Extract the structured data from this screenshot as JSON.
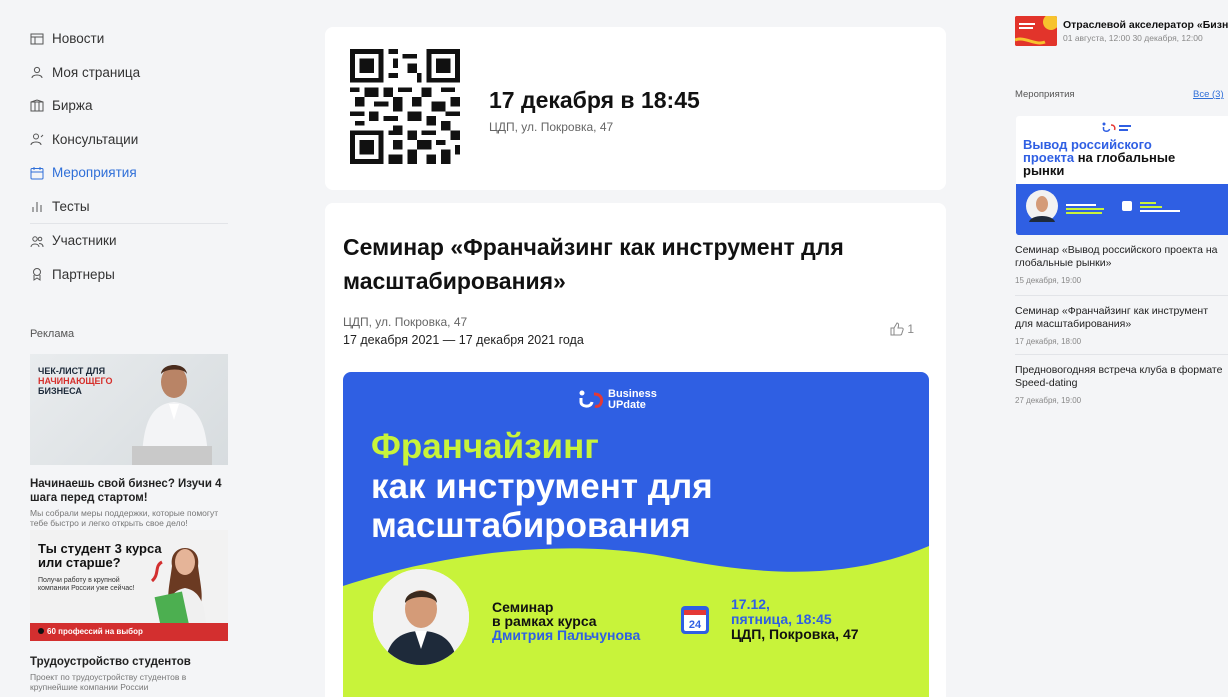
{
  "sidebar": {
    "items": [
      {
        "label": "Новости",
        "icon": "newspaper-icon",
        "active": false
      },
      {
        "label": "Моя страница",
        "icon": "user-icon",
        "active": false
      },
      {
        "label": "Биржа",
        "icon": "exchange-icon",
        "active": false
      },
      {
        "label": "Консультации",
        "icon": "consultation-icon",
        "active": false
      },
      {
        "label": "Мероприятия",
        "icon": "calendar-icon",
        "active": true
      },
      {
        "label": "Тесты",
        "icon": "bar-chart-icon",
        "active": false
      },
      {
        "label": "Участники",
        "icon": "users-icon",
        "active": false
      },
      {
        "label": "Партнеры",
        "icon": "partner-icon",
        "active": false
      }
    ]
  },
  "ads": {
    "heading": "Реклама",
    "ad1": {
      "image_line1": "ЧЕК-ЛИСТ ДЛЯ",
      "image_line2": "НАЧИНАЮЩЕГО",
      "image_line3": "БИЗНЕСА",
      "title": "Начинаешь свой бизнес? Изучи 4 шага перед стартом!",
      "description": "Мы собрали меры поддержки, которые помогут тебе быстро и легко открыть свое дело!"
    },
    "ad2": {
      "image_headline_1": "Ты студент 3 курса",
      "image_headline_2": "или старше?",
      "image_sub": "Получи работу в крупной компании России уже сейчас!",
      "image_bar": "60 профессий на выбор",
      "title": "Трудоустройство студентов",
      "description": "Проект по трудоустройству студентов в крупнейшие компании России"
    }
  },
  "qr_card": {
    "date_time": "17 декабря в 18:45",
    "address": "ЦДП, ул. Покровка, 47"
  },
  "event": {
    "title": "Семинар «Франчайзинг как инструмент для масштабирования»",
    "address": "ЦДП, ул. Покровка, 47",
    "dates": "17 декабря 2021 — 17 декабря 2021 года",
    "likes": "1",
    "banner": {
      "logo_line1": "Business",
      "logo_line2": "UPdate",
      "headline_1": "Франчайзинг",
      "headline_2": "как инструмент для",
      "headline_3": "масштабирования",
      "seminar_1": "Семинар",
      "seminar_2": "в рамках курса",
      "seminar_3": "Дмитрия Пальчунова",
      "calendar_day": "24",
      "date_1": "17.12,",
      "date_2": "пятница, 18:45",
      "date_3": "ЦДП, Покровка, 47"
    }
  },
  "right": {
    "accelerator": {
      "title": "Отраслевой акселератор «Бизн",
      "date": "01 августа, 12:00 30 декабря, 12:00"
    },
    "events_heading": "Мероприятия",
    "events_all": "Все (3)",
    "banner": {
      "line1": "Вывод российского",
      "line2a": "проекта",
      "line2b": " на глобальные",
      "line3": "рынки"
    },
    "events": [
      {
        "title": "Семинар «Вывод российского проекта на глобальные рынки»",
        "date": "15 декабря, 19:00"
      },
      {
        "title": "Семинар «Франчайзинг как инструмент для масштабирования»",
        "date": "17 декабря, 18:00"
      },
      {
        "title": "Предновогодняя встреча клуба в формате Speed-dating",
        "date": "27 декабря, 19:00"
      }
    ]
  },
  "colors": {
    "accent": "#2f6fd8",
    "banner_blue": "#2f5fe3",
    "banner_lime": "#c8f33a",
    "ad_red": "#d32f2f"
  }
}
